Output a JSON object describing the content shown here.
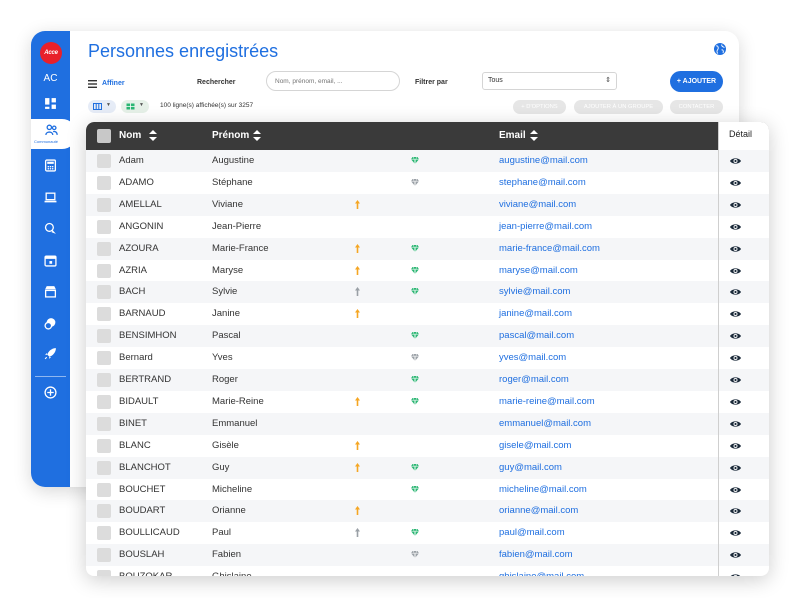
{
  "brand": {
    "logo_text": "Acce",
    "accent": "#1f6fe0",
    "logo_color": "#e8202a"
  },
  "sidebar": {
    "initials": "AC",
    "active_label": "Communauté",
    "items": [
      {
        "name": "dashboard-icon"
      },
      {
        "name": "community-icon"
      },
      {
        "name": "calculator-icon"
      },
      {
        "name": "laptop-icon"
      },
      {
        "name": "chat-icon"
      },
      {
        "name": "calendar-icon"
      },
      {
        "name": "store-icon"
      },
      {
        "name": "coins-icon"
      },
      {
        "name": "rocket-icon"
      },
      {
        "name": "add-circle-icon"
      }
    ]
  },
  "header": {
    "title": "Personnes enregistrées",
    "affiner": "Affiner",
    "rechercher": "Rechercher",
    "search_placeholder": "Nom, prénom, email, ...",
    "filtrer": "Filtrer par",
    "filter_value": "Tous",
    "add_button": "+ AJOUTER",
    "row_count": "100 ligne(s) affichée(s) sur 3257",
    "actions": [
      "+ D'OPTIONS",
      "AJOUTER À UN GROUPE",
      "CONTACTER"
    ]
  },
  "table": {
    "columns": {
      "nom": "Nom",
      "prenom": "Prénom",
      "email": "Email",
      "detail": "Détail"
    },
    "icon_colors": {
      "arrow_orange": "#f5a623",
      "arrow_gray": "#9aa0a6",
      "gem_green": "#2bb673",
      "gem_gray": "#9aa0a6"
    },
    "rows": [
      {
        "nom": "Adam",
        "prenom": "Augustine",
        "email": "augustine@mail.com",
        "arrow": "",
        "gem": "green"
      },
      {
        "nom": "ADAMO",
        "prenom": "Stéphane",
        "email": "stephane@mail.com",
        "arrow": "",
        "gem": "gray"
      },
      {
        "nom": "AMELLAL",
        "prenom": "Viviane",
        "email": "viviane@mail.com",
        "arrow": "orange",
        "gem": ""
      },
      {
        "nom": "ANGONIN",
        "prenom": "Jean-Pierre",
        "email": "jean-pierre@mail.com",
        "arrow": "",
        "gem": ""
      },
      {
        "nom": "AZOURA",
        "prenom": "Marie-France",
        "email": "marie-france@mail.com",
        "arrow": "orange",
        "gem": "green"
      },
      {
        "nom": "AZRIA",
        "prenom": "Maryse",
        "email": "maryse@mail.com",
        "arrow": "orange",
        "gem": "green"
      },
      {
        "nom": "BACH",
        "prenom": "Sylvie",
        "email": "sylvie@mail.com",
        "arrow": "gray",
        "gem": "green"
      },
      {
        "nom": "BARNAUD",
        "prenom": "Janine",
        "email": "janine@mail.com",
        "arrow": "orange",
        "gem": ""
      },
      {
        "nom": "BENSIMHON",
        "prenom": "Pascal",
        "email": "pascal@mail.com",
        "arrow": "",
        "gem": "green"
      },
      {
        "nom": "Bernard",
        "prenom": "Yves",
        "email": "yves@mail.com",
        "arrow": "",
        "gem": "gray"
      },
      {
        "nom": "BERTRAND",
        "prenom": "Roger",
        "email": "roger@mail.com",
        "arrow": "",
        "gem": "green"
      },
      {
        "nom": "BIDAULT",
        "prenom": "Marie-Reine",
        "email": "marie-reine@mail.com",
        "arrow": "orange",
        "gem": "green"
      },
      {
        "nom": "BINET",
        "prenom": "Emmanuel",
        "email": "emmanuel@mail.com",
        "arrow": "",
        "gem": ""
      },
      {
        "nom": "BLANC",
        "prenom": "Gisèle",
        "email": "gisele@mail.com",
        "arrow": "orange",
        "gem": ""
      },
      {
        "nom": "BLANCHOT",
        "prenom": "Guy",
        "email": "guy@mail.com",
        "arrow": "orange",
        "gem": "green"
      },
      {
        "nom": "BOUCHET",
        "prenom": "Micheline",
        "email": "micheline@mail.com",
        "arrow": "",
        "gem": "green"
      },
      {
        "nom": "BOUDART",
        "prenom": "Orianne",
        "email": "orianne@mail.com",
        "arrow": "orange",
        "gem": ""
      },
      {
        "nom": "BOULLICAUD",
        "prenom": "Paul",
        "email": "paul@mail.com",
        "arrow": "gray",
        "gem": "green"
      },
      {
        "nom": "BOUSLAH",
        "prenom": "Fabien",
        "email": "fabien@mail.com",
        "arrow": "",
        "gem": "gray"
      },
      {
        "nom": "BOUZOKAR",
        "prenom": "Ghislaine",
        "email": "ghislaine@mail.com",
        "arrow": "",
        "gem": ""
      }
    ]
  }
}
